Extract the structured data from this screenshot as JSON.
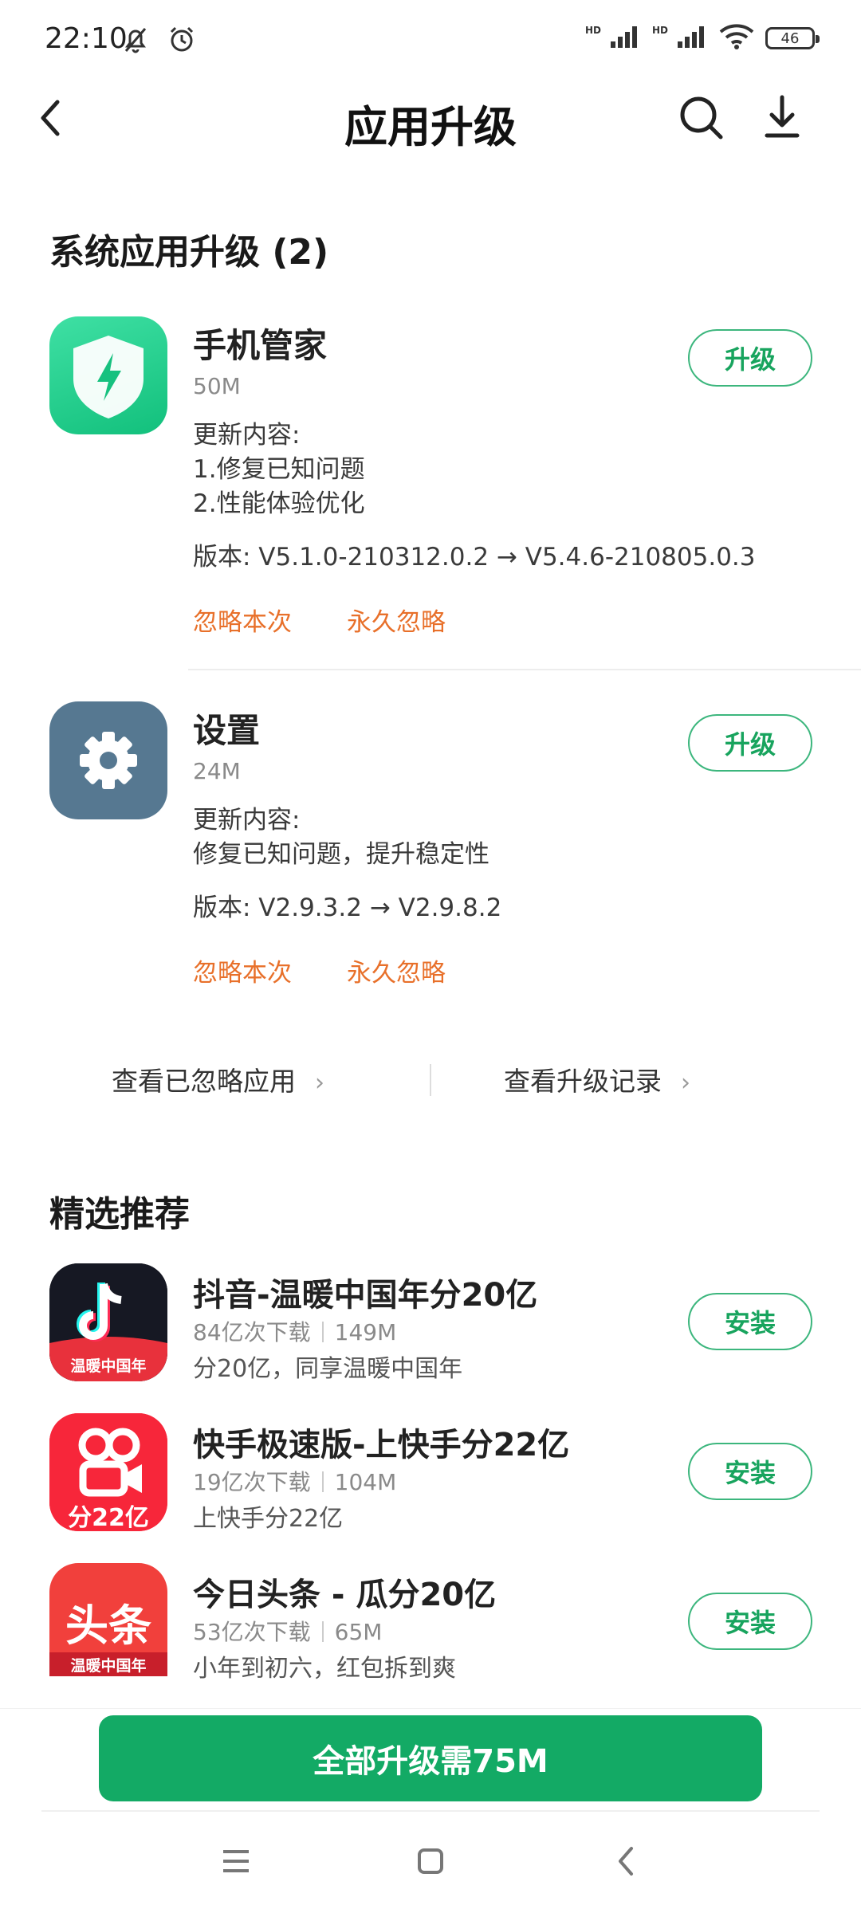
{
  "status_bar": {
    "time": "22:10",
    "signal_tag_1": "HD",
    "signal_tag_2": "HD",
    "battery": "46"
  },
  "header": {
    "title": "应用升级"
  },
  "system_section": {
    "title": "系统应用升级 (2)",
    "apps": [
      {
        "name": "手机管家",
        "size": "50M",
        "changelog_title": "更新内容:",
        "changelog_lines": [
          "1.修复已知问题",
          "2.性能体验优化"
        ],
        "version": "版本: V5.1.0-210312.0.2 → V5.4.6-210805.0.3",
        "button": "升级",
        "ignore_once": "忽略本次",
        "ignore_forever": "永久忽略",
        "icon": "shield-lightning-icon"
      },
      {
        "name": "设置",
        "size": "24M",
        "changelog_title": "更新内容:",
        "changelog_lines": [
          "修复已知问题，提升稳定性"
        ],
        "version": "版本: V2.9.3.2 → V2.9.8.2",
        "button": "升级",
        "ignore_once": "忽略本次",
        "ignore_forever": "永久忽略",
        "icon": "gear-icon"
      }
    ]
  },
  "links": {
    "ignored_apps": "查看已忽略应用",
    "upgrade_history": "查看升级记录"
  },
  "recommend_section": {
    "title": "精选推荐",
    "apps": [
      {
        "name": "抖音-温暖中国年分20亿",
        "downloads": "84亿次下载",
        "size": "149M",
        "desc": "分20亿，同享温暖中国年",
        "button": "安装",
        "icon_caption": "温暖中国年"
      },
      {
        "name": "快手极速版-上快手分22亿",
        "downloads": "19亿次下载",
        "size": "104M",
        "desc": "上快手分22亿",
        "button": "安装",
        "icon_caption": "分22亿"
      },
      {
        "name": "今日头条 - 瓜分20亿",
        "downloads": "53亿次下载",
        "size": "65M",
        "desc": "小年到初六，红包拆到爽",
        "button": "安装",
        "icon_text": "头条",
        "icon_caption": "温暖中国年"
      }
    ]
  },
  "bottom": {
    "upgrade_all": "全部升级需75M"
  },
  "colors": {
    "accent_green": "#13aa65",
    "ignore_orange": "#e8702a"
  }
}
